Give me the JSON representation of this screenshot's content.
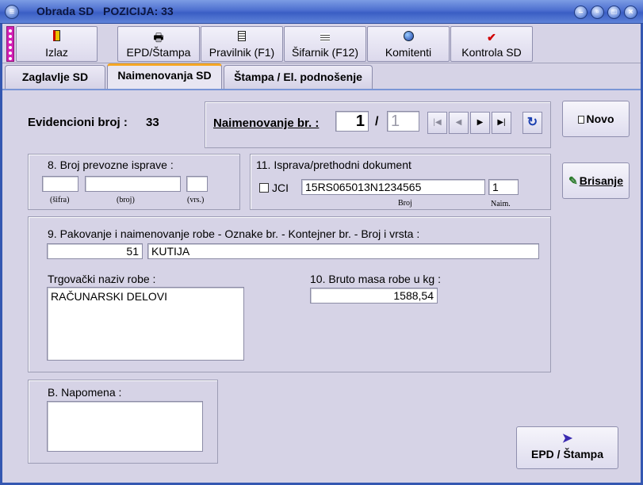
{
  "window": {
    "title": "Obrada SD",
    "position_label": "POZICIJA: 33",
    "controls": [
      "minimize",
      "restore",
      "maximize",
      "close"
    ]
  },
  "toolbar": {
    "izlaz": "Izlaz",
    "epd_stampa": "EPD/Štampa",
    "pravilnik": "Pravilnik (F1)",
    "sifarnik": "Šifarnik (F12)",
    "komitenti": "Komitenti",
    "kontrola": "Kontrola SD"
  },
  "tabs": {
    "zaglavlje": "Zaglavlje SD",
    "naimenovanja": "Naimenovanja SD",
    "stampa": "Štampa / El. podnošenje"
  },
  "header": {
    "evid_label": "Evidencioni broj :",
    "evid_value": "33",
    "naim_label": "Naimenovanje br. :",
    "naim_current": "1",
    "naim_separator": "/",
    "naim_total": "1"
  },
  "buttons": {
    "novo": "Novo",
    "brisanje": "Brisanje",
    "epd_stampa": "EPD / Štampa"
  },
  "prevozna": {
    "title": "8. Broj prevozne isprave :",
    "sifra_label": "(šifra)",
    "broj_label": "(broj)",
    "vrs_label": "(vrs.)",
    "sifra_value": "",
    "broj_value": "",
    "vrs_value": ""
  },
  "isprava": {
    "title": "11. Isprava/prethodni dokument",
    "jci_label": "JCI",
    "jci_checked": false,
    "broj_value": "15RS065013N1234565",
    "naim_value": "1",
    "broj_label": "Broj",
    "naim_label": "Naim."
  },
  "pakovanje": {
    "title": "9. Pakovanje i naimenovanje robe - Oznake br. - Kontejner br. - Broj i vrsta :",
    "count": "51",
    "type": "KUTIJA"
  },
  "roba": {
    "trgovacki_label": "Trgovački naziv robe :",
    "trgovacki_value": "RAČUNARSKI DELOVI",
    "bruto_label": "10. Bruto masa robe u kg :",
    "bruto_value": "1588,54"
  },
  "napomena": {
    "label": "B. Napomena :",
    "value": ""
  },
  "colors": {
    "window_frame": "#3457b1",
    "background": "#d6d3e6",
    "active_tab_accent": "#f4a623",
    "grip": "#d21fb4"
  }
}
